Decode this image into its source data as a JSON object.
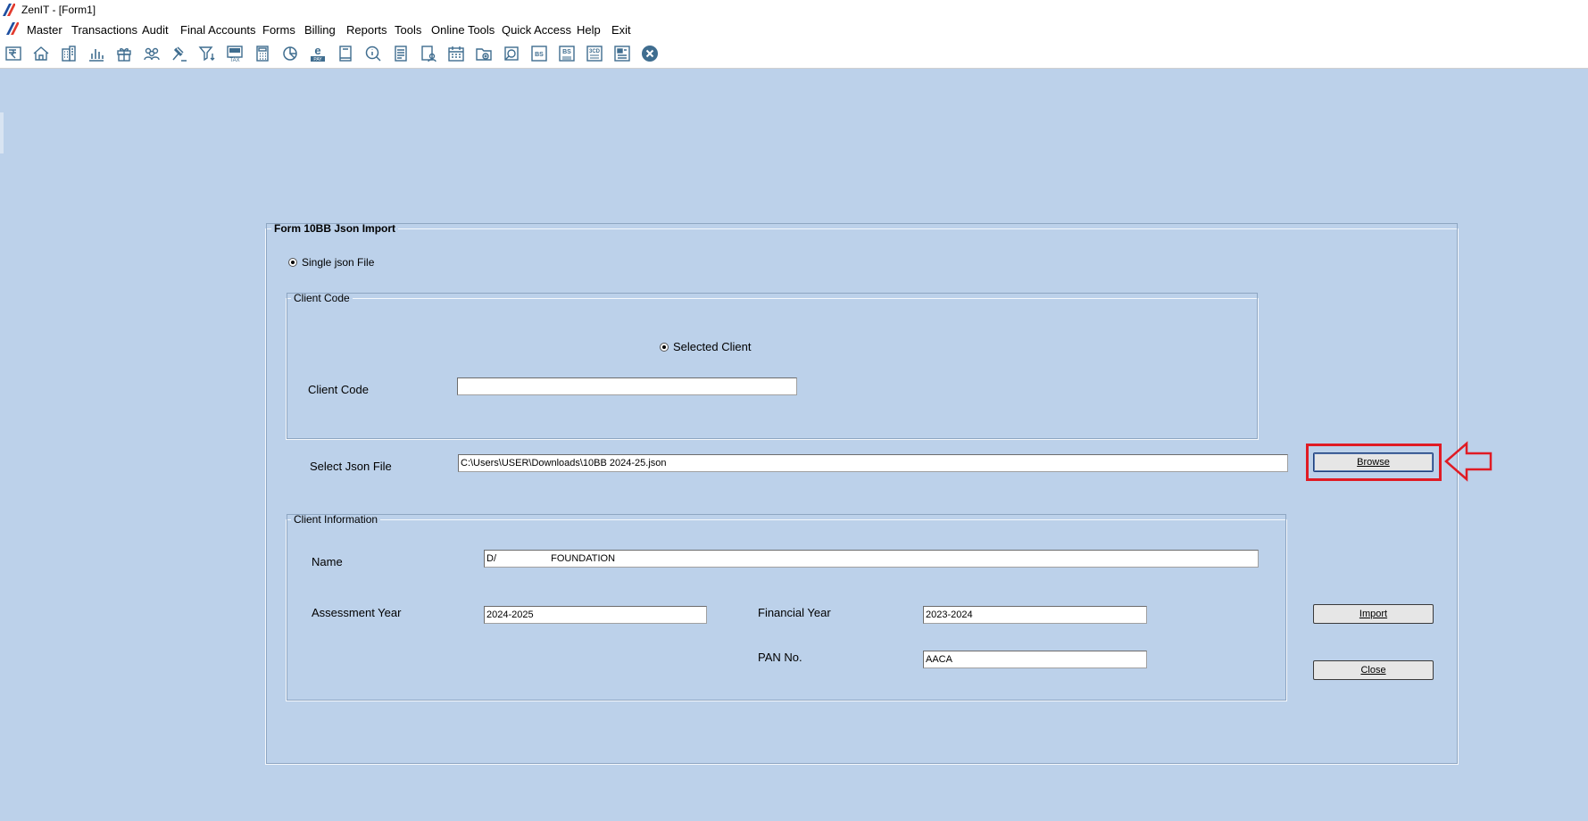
{
  "window": {
    "title": "ZenIT - [Form1]"
  },
  "menu": [
    "Master",
    "Transactions",
    "Audit",
    "Final Accounts",
    "Forms",
    "Billing",
    "Reports",
    "Tools",
    "Online Tools",
    "Quick Access",
    "Help",
    "Exit"
  ],
  "toolbar": {
    "icons": [
      "rupee-book-icon",
      "home-icon",
      "building-icon",
      "bar-chart-icon",
      "gift-icon",
      "users-icon",
      "gavel-icon",
      "filter-icon",
      "tax-icon",
      "calculator-icon",
      "pie-chart-icon",
      "e-pay-icon",
      "book-icon",
      "info-search-icon",
      "report-icon",
      "user-doc-icon",
      "calendar-icon",
      "folder-add-icon",
      "refresh-icon",
      "bs-icon",
      "bs-new-icon",
      "3cd-icon",
      "form-icon",
      "close-circle-icon"
    ],
    "tax_text": "TAX",
    "pay_text": "PAY",
    "bs_text": "BS",
    "cd_text": "3CD"
  },
  "form": {
    "title": "Form 10BB Json Import",
    "single_json_label": "Single json File",
    "client_code_group": "Client Code",
    "selected_client_label": "Selected Client",
    "client_code_label": "Client Code",
    "client_code_value": "",
    "select_json_label": "Select Json File",
    "json_path": "C:\\Users\\USER\\Downloads\\10BB 2024-25.json",
    "browse_label": "Browse",
    "client_info_group": "Client Information",
    "name_label": "Name",
    "name_value": "D/                    FOUNDATION",
    "assessment_year_label": "Assessment Year",
    "assessment_year_value": "2024-2025",
    "financial_year_label": "Financial Year",
    "financial_year_value": "2023-2024",
    "pan_label": "PAN No.",
    "pan_value": "AACA",
    "import_label": "Import",
    "close_label": "Close"
  },
  "colors": {
    "background": "#bcd1ea",
    "highlight": "#e01b24",
    "toolbar_icon": "#3f6d8f"
  }
}
